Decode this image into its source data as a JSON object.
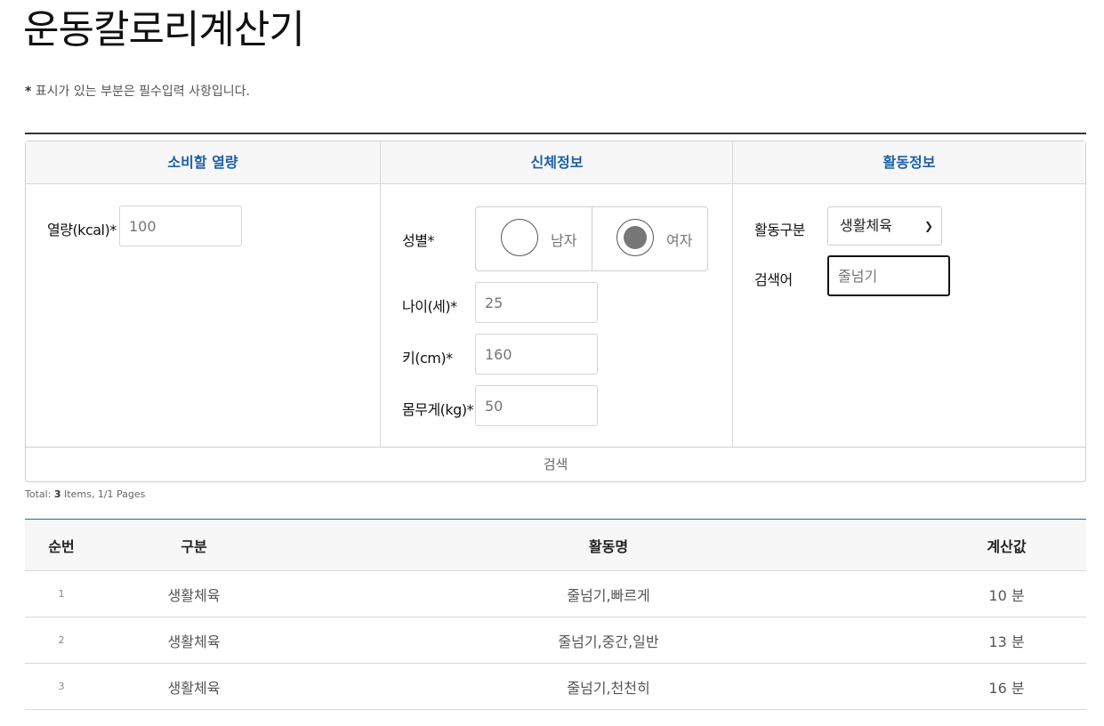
{
  "page": {
    "title": "운동칼로리계산기",
    "notice_mark": "*",
    "notice_text": " 표시가 있는 부분은 필수입력 사항입니다."
  },
  "form": {
    "calorie": {
      "header": "소비할 열량",
      "kcal_label": "열량(kcal)*",
      "kcal_placeholder": "100"
    },
    "body": {
      "header": "신체정보",
      "gender_label": "성별*",
      "gender_options": [
        {
          "label": "남자",
          "checked": false
        },
        {
          "label": "여자",
          "checked": true
        }
      ],
      "age_label": "나이(세)*",
      "age_placeholder": "25",
      "height_label": "키(cm)*",
      "height_placeholder": "160",
      "weight_label": "몸무게(kg)*",
      "weight_placeholder": "50"
    },
    "activity": {
      "header": "활동정보",
      "category_label": "활동구분",
      "category_value": "생활체육",
      "keyword_label": "검색어",
      "keyword_placeholder": "줄넘기"
    },
    "search_button": "검색"
  },
  "results": {
    "total_prefix": "Total: ",
    "total_count": "3",
    "total_suffix": " Items, 1/1 Pages",
    "columns": [
      "순번",
      "구분",
      "활동명",
      "계산값"
    ],
    "rows": [
      {
        "no": "1",
        "category": "생활체육",
        "activity": "줄넘기,빠르게",
        "value": "10 분"
      },
      {
        "no": "2",
        "category": "생활체육",
        "activity": "줄넘기,중간,일반",
        "value": "13 분"
      },
      {
        "no": "3",
        "category": "생활체육",
        "activity": "줄넘기,천천히",
        "value": "16 분"
      }
    ]
  },
  "colors": {
    "accent_blue": "#1d5fa8",
    "header_bg": "#f7f7f7",
    "border": "#cfcfcf",
    "focus_border": "#111111"
  },
  "icons": {
    "select_arrow": "chevron-down-icon"
  }
}
